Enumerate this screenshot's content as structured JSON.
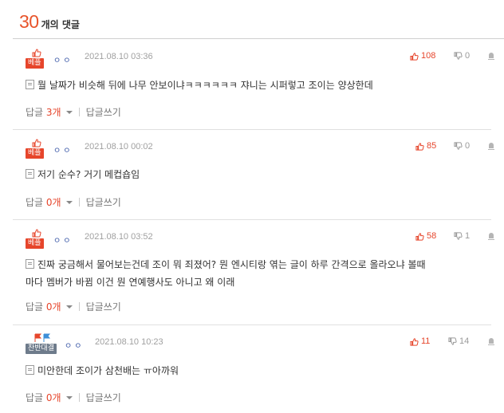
{
  "header": {
    "count": "30",
    "label": "개의 댓글"
  },
  "colors": {
    "accent": "#e8542b",
    "like": "#e6452b",
    "badge_grey": "#6e7b8b"
  },
  "comments": [
    {
      "badge": "베플",
      "badge_style": "best",
      "dots": "ㅇㅇ",
      "date": "2021.08.10 03:36",
      "likes": "108",
      "dislikes": "0",
      "lines": [
        "뭘 날짜가 비슷해 뒤에 나무 안보이냐ㅋㅋㅋㅋㅋㅋ 쟈니는 시퍼렇고 조이는 양상한데"
      ],
      "reply_label": "답글",
      "reply_count": "3개",
      "write_reply": "답글쓰기"
    },
    {
      "badge": "베플",
      "badge_style": "best",
      "dots": "ㅇㅇ",
      "date": "2021.08.10 00:02",
      "likes": "85",
      "dislikes": "0",
      "lines": [
        "저기 순수? 거기 메컵숍임"
      ],
      "reply_label": "답글",
      "reply_count": "0개",
      "write_reply": "답글쓰기"
    },
    {
      "badge": "베플",
      "badge_style": "best",
      "dots": "ㅇㅇ",
      "date": "2021.08.10 03:52",
      "likes": "58",
      "dislikes": "1",
      "lines": [
        "진짜 궁금해서 물어보는건데 조이 뭐 죄졌어? 뭔 엔시티랑 엮는 글이 하루 간격으로 올라오냐 볼때",
        "마다 멤버가 바뀜 이건 뭔 연예행사도 아니고 왜 이래"
      ],
      "reply_label": "답글",
      "reply_count": "0개",
      "write_reply": "답글쓰기"
    },
    {
      "badge": "찬반대결",
      "badge_style": "versus",
      "dots": "ㅇㅇ",
      "date": "2021.08.10 10:23",
      "likes": "11",
      "dislikes": "14",
      "lines": [
        "미안한데 조이가 삼천배는 ㅠ아까워"
      ],
      "reply_label": "답글",
      "reply_count": "0개",
      "write_reply": "답글쓰기"
    }
  ]
}
